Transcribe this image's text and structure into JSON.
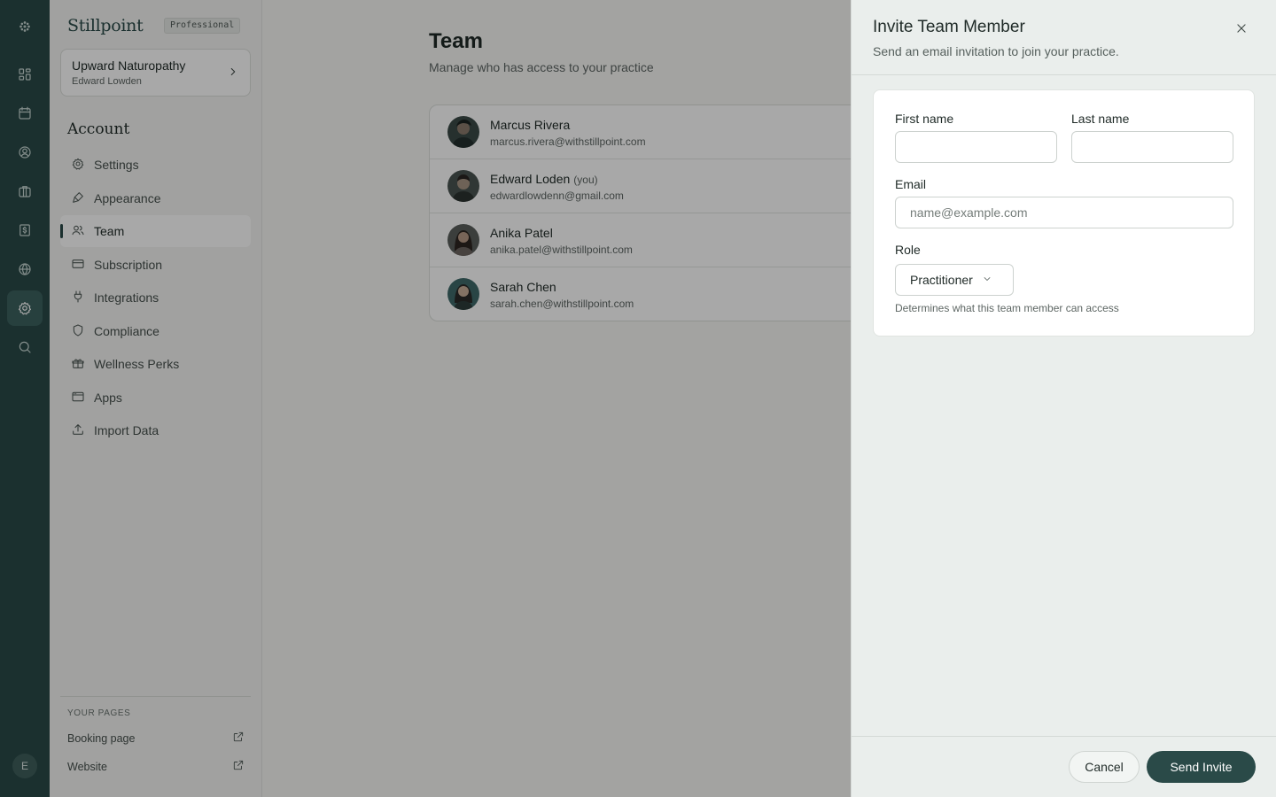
{
  "rail": {
    "items": [
      {
        "icon": "dashboard-icon"
      },
      {
        "icon": "calendar-icon"
      },
      {
        "icon": "clients-icon"
      },
      {
        "icon": "briefcase-icon"
      },
      {
        "icon": "billing-icon"
      },
      {
        "icon": "globe-icon"
      },
      {
        "icon": "settings-icon",
        "active": true
      },
      {
        "icon": "search-icon"
      }
    ],
    "user_initial": "E"
  },
  "sidebar": {
    "brand": "Stillpoint",
    "plan": "Professional",
    "practice": {
      "name": "Upward Naturopathy",
      "owner": "Edward Lowden"
    },
    "section_title": "Account",
    "items": [
      {
        "label": "Settings",
        "icon": "gear-icon"
      },
      {
        "label": "Appearance",
        "icon": "brush-icon"
      },
      {
        "label": "Team",
        "icon": "users-icon",
        "active": true
      },
      {
        "label": "Subscription",
        "icon": "card-icon"
      },
      {
        "label": "Integrations",
        "icon": "plug-icon"
      },
      {
        "label": "Compliance",
        "icon": "shield-icon"
      },
      {
        "label": "Wellness Perks",
        "icon": "gift-icon"
      },
      {
        "label": "Apps",
        "icon": "app-window-icon"
      },
      {
        "label": "Import Data",
        "icon": "upload-icon"
      }
    ],
    "pages_title": "YOUR PAGES",
    "pages": [
      {
        "label": "Booking page"
      },
      {
        "label": "Website"
      }
    ]
  },
  "main": {
    "title": "Team",
    "subtitle": "Manage who has access to your practice",
    "members": [
      {
        "name": "Marcus Rivera",
        "you": "",
        "email": "marcus.rivera@withstillpoint.com"
      },
      {
        "name": "Edward Loden",
        "you": "(you)",
        "email": "edwardlowdenn@gmail.com"
      },
      {
        "name": "Anika Patel",
        "you": "",
        "email": "anika.patel@withstillpoint.com"
      },
      {
        "name": "Sarah Chen",
        "you": "",
        "email": "sarah.chen@withstillpoint.com"
      }
    ]
  },
  "drawer": {
    "title": "Invite Team Member",
    "subtitle": "Send an email invitation to join your practice.",
    "first_name_label": "First name",
    "first_name_value": "",
    "last_name_label": "Last name",
    "last_name_value": "",
    "email_label": "Email",
    "email_placeholder": "name@example.com",
    "role_label": "Role",
    "role_value": "Practitioner",
    "role_hint": "Determines what this team member can access",
    "cancel_label": "Cancel",
    "send_label": "Send Invite"
  },
  "colors": {
    "brand": "#2a4a48",
    "rail_bg": "#2a4a48",
    "overlay": "rgba(0,0,0,0.34)"
  }
}
